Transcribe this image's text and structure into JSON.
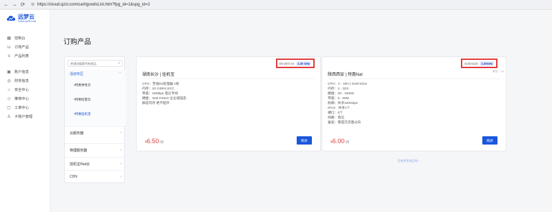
{
  "browser": {
    "back": "←",
    "forward": "→",
    "reload": "⟳",
    "url": "https://cloud.qzsl.com/cart/goodsList.htm?fpg_id=1&spg_id=2"
  },
  "logo": {
    "cn": "远梦云",
    "en": "Cloud.QzSl.CoM",
    "color": "#1a56db"
  },
  "sidebar": {
    "items": [
      {
        "label": "控制台",
        "icon": "dashboard-icon"
      },
      {
        "label": "订购产品",
        "icon": "cart-icon"
      },
      {
        "label": "产品列表",
        "icon": "list-icon"
      },
      {
        "label": "账户信息",
        "icon": "user-icon"
      },
      {
        "label": "财务信息",
        "icon": "finance-icon"
      },
      {
        "label": "安全中心",
        "icon": "security-icon"
      },
      {
        "label": "推荐中心",
        "icon": "tag-icon"
      },
      {
        "label": "工单中心",
        "icon": "ticket-icon"
      },
      {
        "label": "子账户管理",
        "icon": "subaccount-icon"
      }
    ]
  },
  "page": {
    "title": "订购产品"
  },
  "categories": {
    "search_placeholder": "关键词搜索所有商品",
    "active_group": "活动专区",
    "sub_items": [
      "特惠弹性云",
      "特惠轻量云",
      "特惠挂机宝"
    ],
    "other_groups": [
      "云服务器",
      "物理服务器",
      "挂机宝/Nat云",
      "CDN"
    ]
  },
  "products": [
    {
      "title": "湖南长沙 | 挂机宝",
      "cpu_model": "E5-2673 v4",
      "freq": "2.30 GHz",
      "stock": "",
      "specs": [
        "CPU：至强E5处理器 1核",
        "内存：2G DDR4 ECC",
        "带宽：20Mbps 电信专线",
        "硬盘：Intel P4510 企业级固态",
        "静态内存 绝不超开"
      ],
      "currency": "¥",
      "price": "6.50",
      "unit": "/月",
      "buy_label": "购买"
    },
    {
      "title": "陕西西安 | 特惠Nat",
      "cpu_model": "Gold 5218",
      "freq": "2.30GHz",
      "stock": "库存：19",
      "specs": [
        "CPU：2 - 16H | Gold 5218",
        "内存：2 - 32G",
        "硬盘：30 - 1000G",
        "带宽：5 - 50M",
        "防御：共享100Gbps",
        "IPV4：共享1个",
        "端口：5个",
        "线路：电信",
        "备案：需提交流量过白"
      ],
      "currency": "¥",
      "price": "6.00",
      "unit": "/月",
      "buy_label": "购买"
    }
  ],
  "more_text": "没有更多商品啦~",
  "colors": {
    "accent": "#1a56db",
    "price": "#e23b3b",
    "highlight_border": "#e23b3b"
  }
}
